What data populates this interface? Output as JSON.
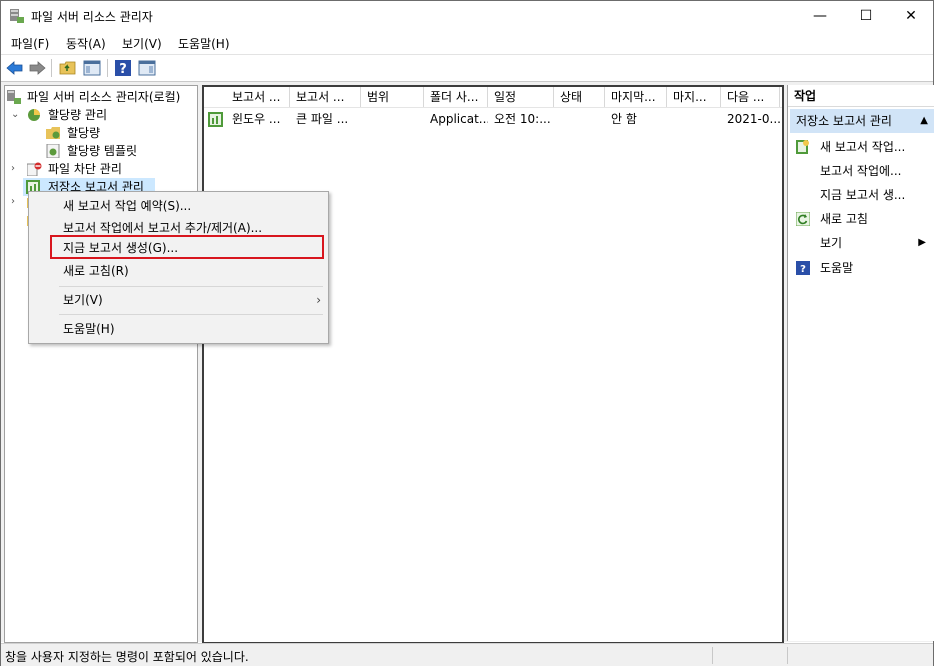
{
  "window": {
    "title": "파일 서버 리소스 관리자",
    "minimize": "—",
    "maximize": "☐",
    "close": "✕"
  },
  "menubar": [
    "파일(F)",
    "동작(A)",
    "보기(V)",
    "도움말(H)"
  ],
  "tree": {
    "root": "파일 서버 리소스 관리자(로컬)",
    "quota_mgmt": "할당량 관리",
    "quotas": "할당량",
    "quota_templates": "할당량 템플릿",
    "file_screen": "파일 차단 관리",
    "storage_reports": "저장소 보고서 관리"
  },
  "list": {
    "columns": [
      "보고서 ...",
      "보고서 ...",
      "범위",
      "폴더 사...",
      "일정",
      "상태",
      "마지막...",
      "마지...",
      "다음 ..."
    ],
    "rows": [
      [
        "윈도우 ...",
        "큰 파일 ...",
        "",
        "Applicat...",
        "오전 10:...",
        "",
        "안 함",
        "",
        "2021-0..."
      ]
    ]
  },
  "actions": {
    "header": "작업",
    "section": "저장소 보고서 관리",
    "items": [
      "새 보고서 작업...",
      "보고서 작업에...",
      "지금 보고서 생...",
      "새로 고침",
      "보기",
      "도움말"
    ]
  },
  "context_menu": {
    "items": [
      "새 보고서 작업 예약(S)...",
      "보고서 작업에서 보고서 추가/제거(A)...",
      "지금 보고서 생성(G)...",
      "새로 고침(R)",
      "보기(V)",
      "도움말(H)"
    ],
    "highlighted": "지금 보고서 생성(G)..."
  },
  "statusbar": {
    "text": "창을 사용자 지정하는 명령이 포함되어 있습니다."
  },
  "colors": {
    "selection": "#cce8ff",
    "action_section": "#d1e4f7",
    "highlight_box": "#d8161e"
  }
}
